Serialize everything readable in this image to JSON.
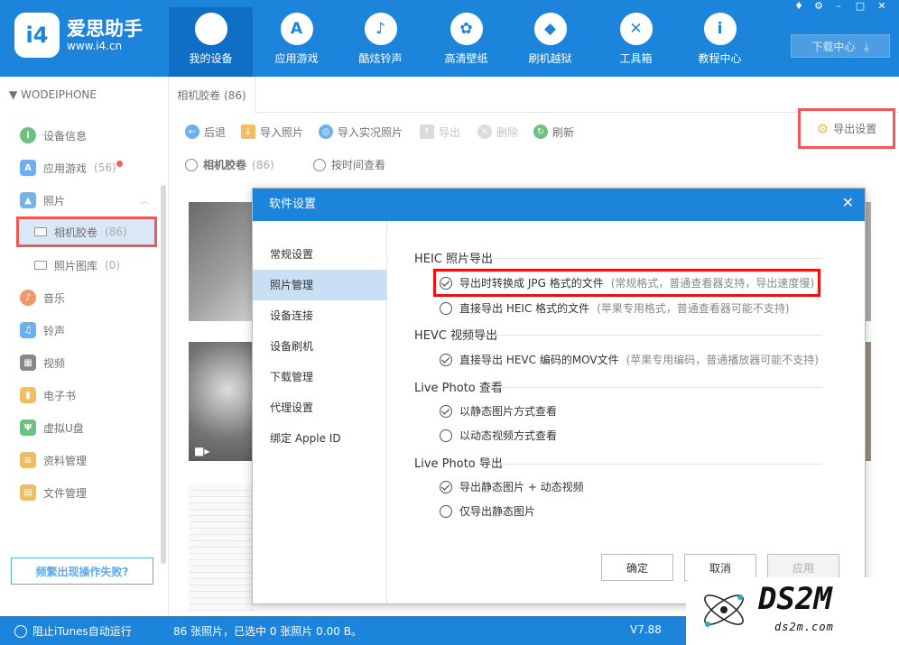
{
  "app": {
    "name": "爱思助手",
    "url": "www.i4.cn",
    "logo_text": "i4"
  },
  "nav": [
    {
      "label": "我的设备",
      "icon": "apple-icon",
      "glyph": ""
    },
    {
      "label": "应用游戏",
      "icon": "app-store-icon",
      "glyph": "A"
    },
    {
      "label": "酷炫铃声",
      "icon": "bell-icon",
      "glyph": "♪"
    },
    {
      "label": "高清壁纸",
      "icon": "flower-icon",
      "glyph": "✿"
    },
    {
      "label": "刷机越狱",
      "icon": "dropbox-icon",
      "glyph": "◆"
    },
    {
      "label": "工具箱",
      "icon": "tools-icon",
      "glyph": "✕"
    },
    {
      "label": "教程中心",
      "icon": "info-icon",
      "glyph": "i"
    }
  ],
  "window_controls": [
    "♦",
    "⚙",
    "–",
    "□",
    "✕"
  ],
  "download_center": "下载中心",
  "sidebar": {
    "device": "WODEIPHONE",
    "items": [
      {
        "label": "设备信息",
        "icon": "info-icon",
        "color": "#2ca84a"
      },
      {
        "label": "应用游戏",
        "count": "(56)",
        "icon": "app-store-icon",
        "color": "#2d8ee8"
      },
      {
        "label": "照片",
        "icon": "photo-icon",
        "color": "#3a93e0"
      },
      {
        "label": "音乐",
        "icon": "music-icon",
        "color": "#f06a2c"
      },
      {
        "label": "铃声",
        "icon": "bell-icon",
        "color": "#2d8ee8"
      },
      {
        "label": "视频",
        "icon": "film-icon",
        "color": "#555555"
      },
      {
        "label": "电子书",
        "icon": "book-icon",
        "color": "#f0a020"
      },
      {
        "label": "虚拟U盘",
        "icon": "usb-icon",
        "color": "#2ca84a"
      },
      {
        "label": "资料管理",
        "icon": "notes-icon",
        "color": "#e5a020"
      },
      {
        "label": "文件管理",
        "icon": "file-icon",
        "color": "#e5a020"
      }
    ],
    "photo_sub": [
      {
        "label": "相机胶卷",
        "count": "(86)"
      },
      {
        "label": "照片图库",
        "count": "(0)"
      }
    ],
    "help_button": "频繁出现操作失败?"
  },
  "tab": "相机胶卷 (86)",
  "toolbar": [
    {
      "label": "后退",
      "icon": "back-icon"
    },
    {
      "label": "导入照片",
      "icon": "import-icon"
    },
    {
      "label": "导入实况照片",
      "icon": "live-photo-icon"
    },
    {
      "label": "导出",
      "icon": "export-icon"
    },
    {
      "label": "删除",
      "icon": "delete-icon"
    },
    {
      "label": "刷新",
      "icon": "refresh-icon"
    }
  ],
  "export_settings": "导出设置",
  "filters": {
    "roll": "相机胶卷",
    "roll_count": "(86)",
    "by_time": "按时间查看"
  },
  "dialog": {
    "title": "软件设置",
    "menu": [
      "常规设置",
      "照片管理",
      "设备连接",
      "设备刷机",
      "下载管理",
      "代理设置",
      "绑定 Apple ID"
    ],
    "sections": {
      "heic": "HEIC 照片导出",
      "heic_opt1": "导出时转换成 JPG 格式的文件",
      "heic_opt1_hint": "(常规格式，普通查看器支持，导出速度慢)",
      "heic_opt2": "直接导出 HEIC 格式的文件",
      "heic_opt2_hint": "(苹果专用格式，普通查看器可能不支持)",
      "hevc": "HEVC 视频导出",
      "hevc_opt1": "直接导出 HEVC 编码的MOV文件",
      "hevc_opt1_hint": "(苹果专用编码，普通播放器可能不支持)",
      "live_view": "Live Photo 查看",
      "live_view_opt1": "以静态图片方式查看",
      "live_view_opt2": "以动态视频方式查看",
      "live_export": "Live Photo 导出",
      "live_export_opt1": "导出静态图片 + 动态视频",
      "live_export_opt2": "仅导出静态图片"
    },
    "buttons": {
      "ok": "确定",
      "cancel": "取消",
      "apply": "应用"
    }
  },
  "status": {
    "itunes": "阻止iTunes自动运行",
    "summary": "86 张照片，已选中 0 张照片 0.00 B。",
    "version": "V7.88"
  },
  "watermark": {
    "big": "DS2M",
    "small": "ds2m.com"
  }
}
